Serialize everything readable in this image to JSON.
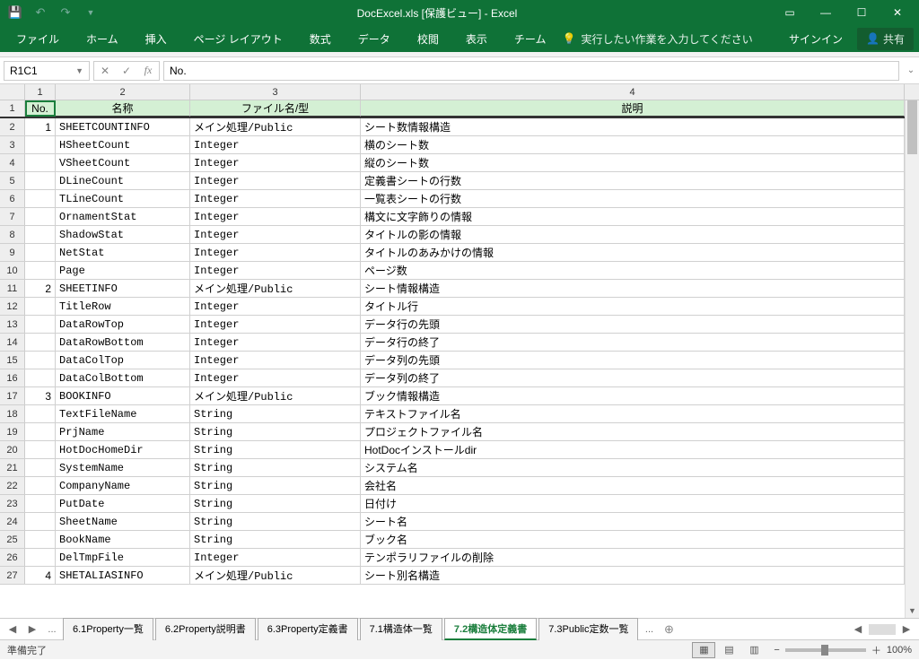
{
  "titlebar": {
    "doc": "DocExcel.xls  [保護ビュー] - Excel"
  },
  "ribbon": {
    "tabs": [
      "ファイル",
      "ホーム",
      "挿入",
      "ページ レイアウト",
      "数式",
      "データ",
      "校閲",
      "表示",
      "チーム"
    ],
    "tell": "実行したい作業を入力してください",
    "signin": "サインイン",
    "share": "共有"
  },
  "formula": {
    "name_box": "R1C1",
    "content": "No."
  },
  "columns": [
    "1",
    "2",
    "3",
    "4"
  ],
  "header_row": [
    "No.",
    "名称",
    "ファイル名/型",
    "説明"
  ],
  "rows": [
    {
      "n": "1",
      "no": "1",
      "name": "SHEETCOUNTINFO",
      "type": "メイン処理/Public",
      "desc": "シート数情報構造"
    },
    {
      "n": "2",
      "no": "",
      "name": "HSheetCount",
      "type": "Integer",
      "desc": "横のシート数"
    },
    {
      "n": "3",
      "no": "",
      "name": "VSheetCount",
      "type": "Integer",
      "desc": "縦のシート数"
    },
    {
      "n": "4",
      "no": "",
      "name": "DLineCount",
      "type": "Integer",
      "desc": "定義書シートの行数"
    },
    {
      "n": "5",
      "no": "",
      "name": "TLineCount",
      "type": "Integer",
      "desc": "一覧表シートの行数"
    },
    {
      "n": "6",
      "no": "",
      "name": "OrnamentStat",
      "type": "Integer",
      "desc": "構文に文字飾りの情報"
    },
    {
      "n": "7",
      "no": "",
      "name": "ShadowStat",
      "type": "Integer",
      "desc": "タイトルの影の情報"
    },
    {
      "n": "8",
      "no": "",
      "name": "NetStat",
      "type": "Integer",
      "desc": "タイトルのあみかけの情報"
    },
    {
      "n": "9",
      "no": "",
      "name": "Page",
      "type": "Integer",
      "desc": "ページ数"
    },
    {
      "n": "10",
      "no": "2",
      "name": "SHEETINFO",
      "type": "メイン処理/Public",
      "desc": "シート情報構造"
    },
    {
      "n": "11",
      "no": "",
      "name": "TitleRow",
      "type": "Integer",
      "desc": "タイトル行"
    },
    {
      "n": "12",
      "no": "",
      "name": "DataRowTop",
      "type": "Integer",
      "desc": "データ行の先頭"
    },
    {
      "n": "13",
      "no": "",
      "name": "DataRowBottom",
      "type": "Integer",
      "desc": "データ行の終了"
    },
    {
      "n": "14",
      "no": "",
      "name": "DataColTop",
      "type": "Integer",
      "desc": "データ列の先頭"
    },
    {
      "n": "15",
      "no": "",
      "name": "DataColBottom",
      "type": "Integer",
      "desc": "データ列の終了"
    },
    {
      "n": "16",
      "no": "3",
      "name": "BOOKINFO",
      "type": "メイン処理/Public",
      "desc": "ブック情報構造"
    },
    {
      "n": "17",
      "no": "",
      "name": "TextFileName",
      "type": "String",
      "desc": "テキストファイル名"
    },
    {
      "n": "18",
      "no": "",
      "name": "PrjName",
      "type": "String",
      "desc": "プロジェクトファイル名"
    },
    {
      "n": "19",
      "no": "",
      "name": "HotDocHomeDir",
      "type": "String",
      "desc": "HotDocインストールdir"
    },
    {
      "n": "20",
      "no": "",
      "name": "SystemName",
      "type": "String",
      "desc": "システム名"
    },
    {
      "n": "21",
      "no": "",
      "name": "CompanyName",
      "type": "String",
      "desc": "会社名"
    },
    {
      "n": "22",
      "no": "",
      "name": "PutDate",
      "type": "String",
      "desc": "日付け"
    },
    {
      "n": "23",
      "no": "",
      "name": "SheetName",
      "type": "String",
      "desc": "シート名"
    },
    {
      "n": "24",
      "no": "",
      "name": "BookName",
      "type": "String",
      "desc": "ブック名"
    },
    {
      "n": "25",
      "no": "",
      "name": "DelTmpFile",
      "type": "Integer",
      "desc": "テンポラリファイルの削除"
    },
    {
      "n": "26",
      "no": "4",
      "name": "SHETALIASINFO",
      "type": "メイン処理/Public",
      "desc": "シート別名構造"
    }
  ],
  "sheet_tabs": {
    "ellipsis": "...",
    "tabs": [
      "6.1Property一覧",
      "6.2Property説明書",
      "6.3Property定義書",
      "7.1構造体一覧",
      "7.2構造体定義書",
      "7.3Public定数一覧"
    ],
    "active_index": 4,
    "ellipsis2": "..."
  },
  "status": {
    "ready": "準備完了",
    "zoom": "100%",
    "minus": "−",
    "plus": "＋"
  }
}
